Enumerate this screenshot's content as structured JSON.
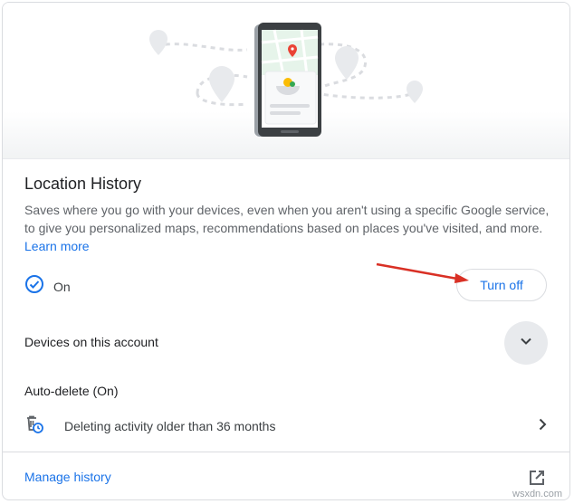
{
  "location_history": {
    "title": "Location History",
    "description": "Saves where you go with your devices, even when you aren't using a specific Google service, to give you personalized maps, recommendations based on places you've visited, and more.",
    "learn_more": "Learn more",
    "status": "On",
    "turn_off_label": "Turn off"
  },
  "devices": {
    "label": "Devices on this account"
  },
  "auto_delete": {
    "title": "Auto-delete (On)",
    "detail": "Deleting activity older than 36 months"
  },
  "footer": {
    "manage_label": "Manage history"
  },
  "watermark": "wsxdn.com",
  "colors": {
    "accent": "#1a73e8",
    "annotation_arrow": "#d93025"
  },
  "icons": [
    "map-illustration",
    "check-circle-icon",
    "chevron-down-icon",
    "auto-delete-icon",
    "chevron-right-icon",
    "open-in-new-icon"
  ]
}
